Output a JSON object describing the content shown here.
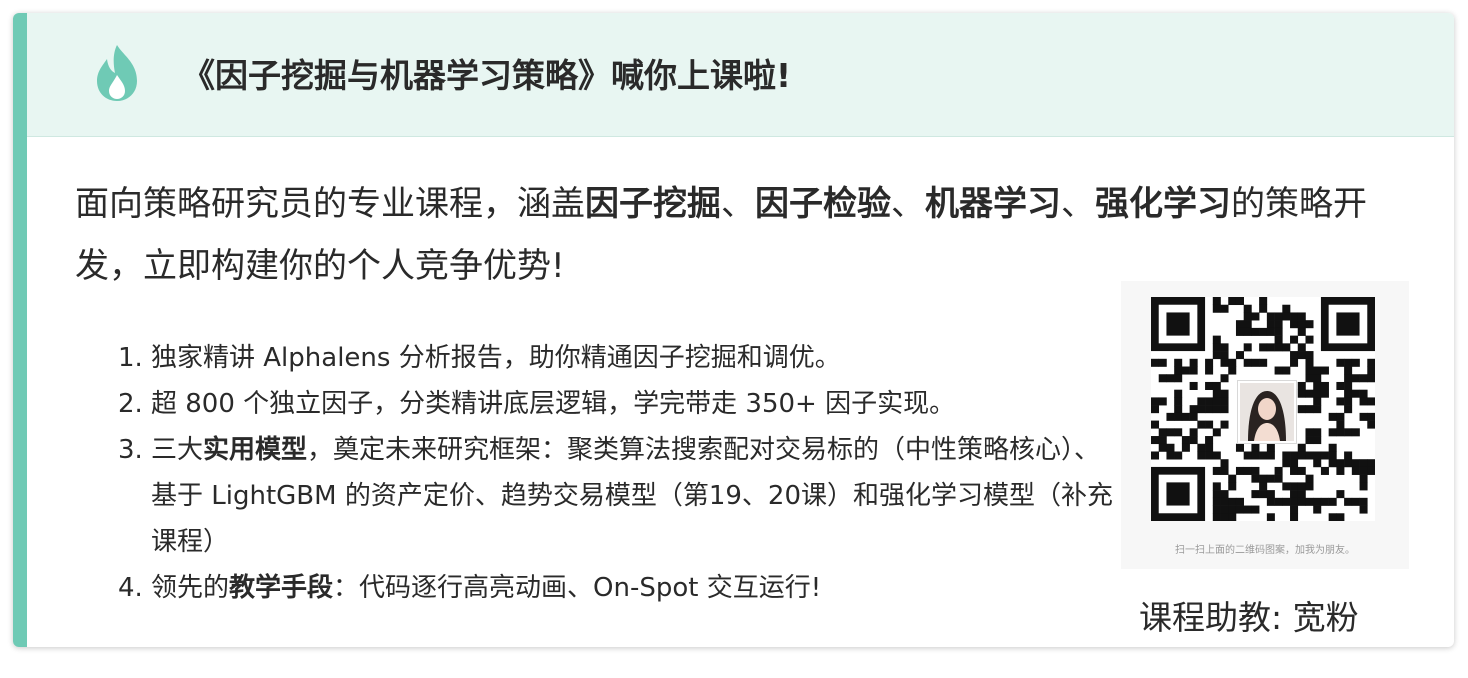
{
  "header": {
    "icon": "flame-icon",
    "title": "《因子挖掘与机器学习策略》喊你上课啦!"
  },
  "intro": {
    "part1": "面向策略研究员的专业课程，涵盖",
    "bold1": "因子挖掘",
    "sep1": "、",
    "bold2": "因子检验",
    "sep2": "、",
    "bold3": "机器学习",
    "sep3": "、",
    "bold4": "强化学习",
    "part2": "的策略开发，立即构建你的个人竞争优势!"
  },
  "features": [
    {
      "num": "1.",
      "text": "独家精讲 Alphalens 分析报告，助你精通因子挖掘和调优。"
    },
    {
      "num": "2.",
      "text": "超 800 个独立因子，分类精讲底层逻辑，学完带走 350+ 因子实现。"
    },
    {
      "num": "3.",
      "pre": "三大",
      "bold": "实用模型",
      "text": "，奠定未来研究框架：聚类算法搜索配对交易标的（中性策略核心）、基于 LightGBM 的资产定价、趋势交易模型（第19、20课）和强化学习模型（补充课程）"
    },
    {
      "num": "4.",
      "pre": "领先的",
      "bold": "教学手段",
      "text": "：代码逐行高亮动画、On-Spot 交互运行!"
    }
  ],
  "qr": {
    "icon": "qr-code-icon",
    "caption": "扫一扫上面的二维码图案，加我为朋友。"
  },
  "assistant": {
    "label": "课程助教: 宽粉"
  },
  "colors": {
    "accent": "#6fcab5",
    "header_bg": "#e8f6f2",
    "text": "#2a2a2a"
  }
}
